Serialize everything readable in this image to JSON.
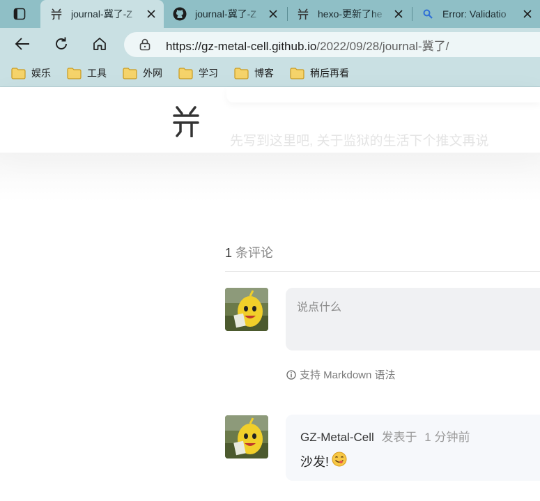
{
  "browser": {
    "tabs": [
      {
        "title": "journal-冀了-Z",
        "active": true,
        "icon": "site-logo-icon"
      },
      {
        "title": "journal-冀了-Z",
        "active": false,
        "icon": "github-icon"
      },
      {
        "title": "hexo-更新了he",
        "active": false,
        "icon": "site-logo-icon"
      },
      {
        "title": "Error: Validatio",
        "active": false,
        "icon": "search-icon"
      }
    ],
    "url_host": "https://gz-metal-cell.github.io",
    "url_path": "/2022/09/28/journal-冀了/",
    "bookmarks": [
      "娱乐",
      "工具",
      "外网",
      "学习",
      "博客",
      "稍后再看"
    ]
  },
  "page": {
    "ghost_text": "先写到这里吧, 关于监狱的生活下个推文再说",
    "comments": {
      "count": "1",
      "count_suffix": "条评论",
      "placeholder": "说点什么",
      "markdown_hint": "支持 Markdown 语法",
      "items": [
        {
          "author": "GZ-Metal-Cell",
          "posted_label": "发表于",
          "time": "1 分钟前",
          "text": "沙发!"
        }
      ]
    }
  },
  "colors": {
    "chrome": "#c9e0e3",
    "tabbar": "#8fbfc6",
    "folder": "#f2c94c"
  }
}
